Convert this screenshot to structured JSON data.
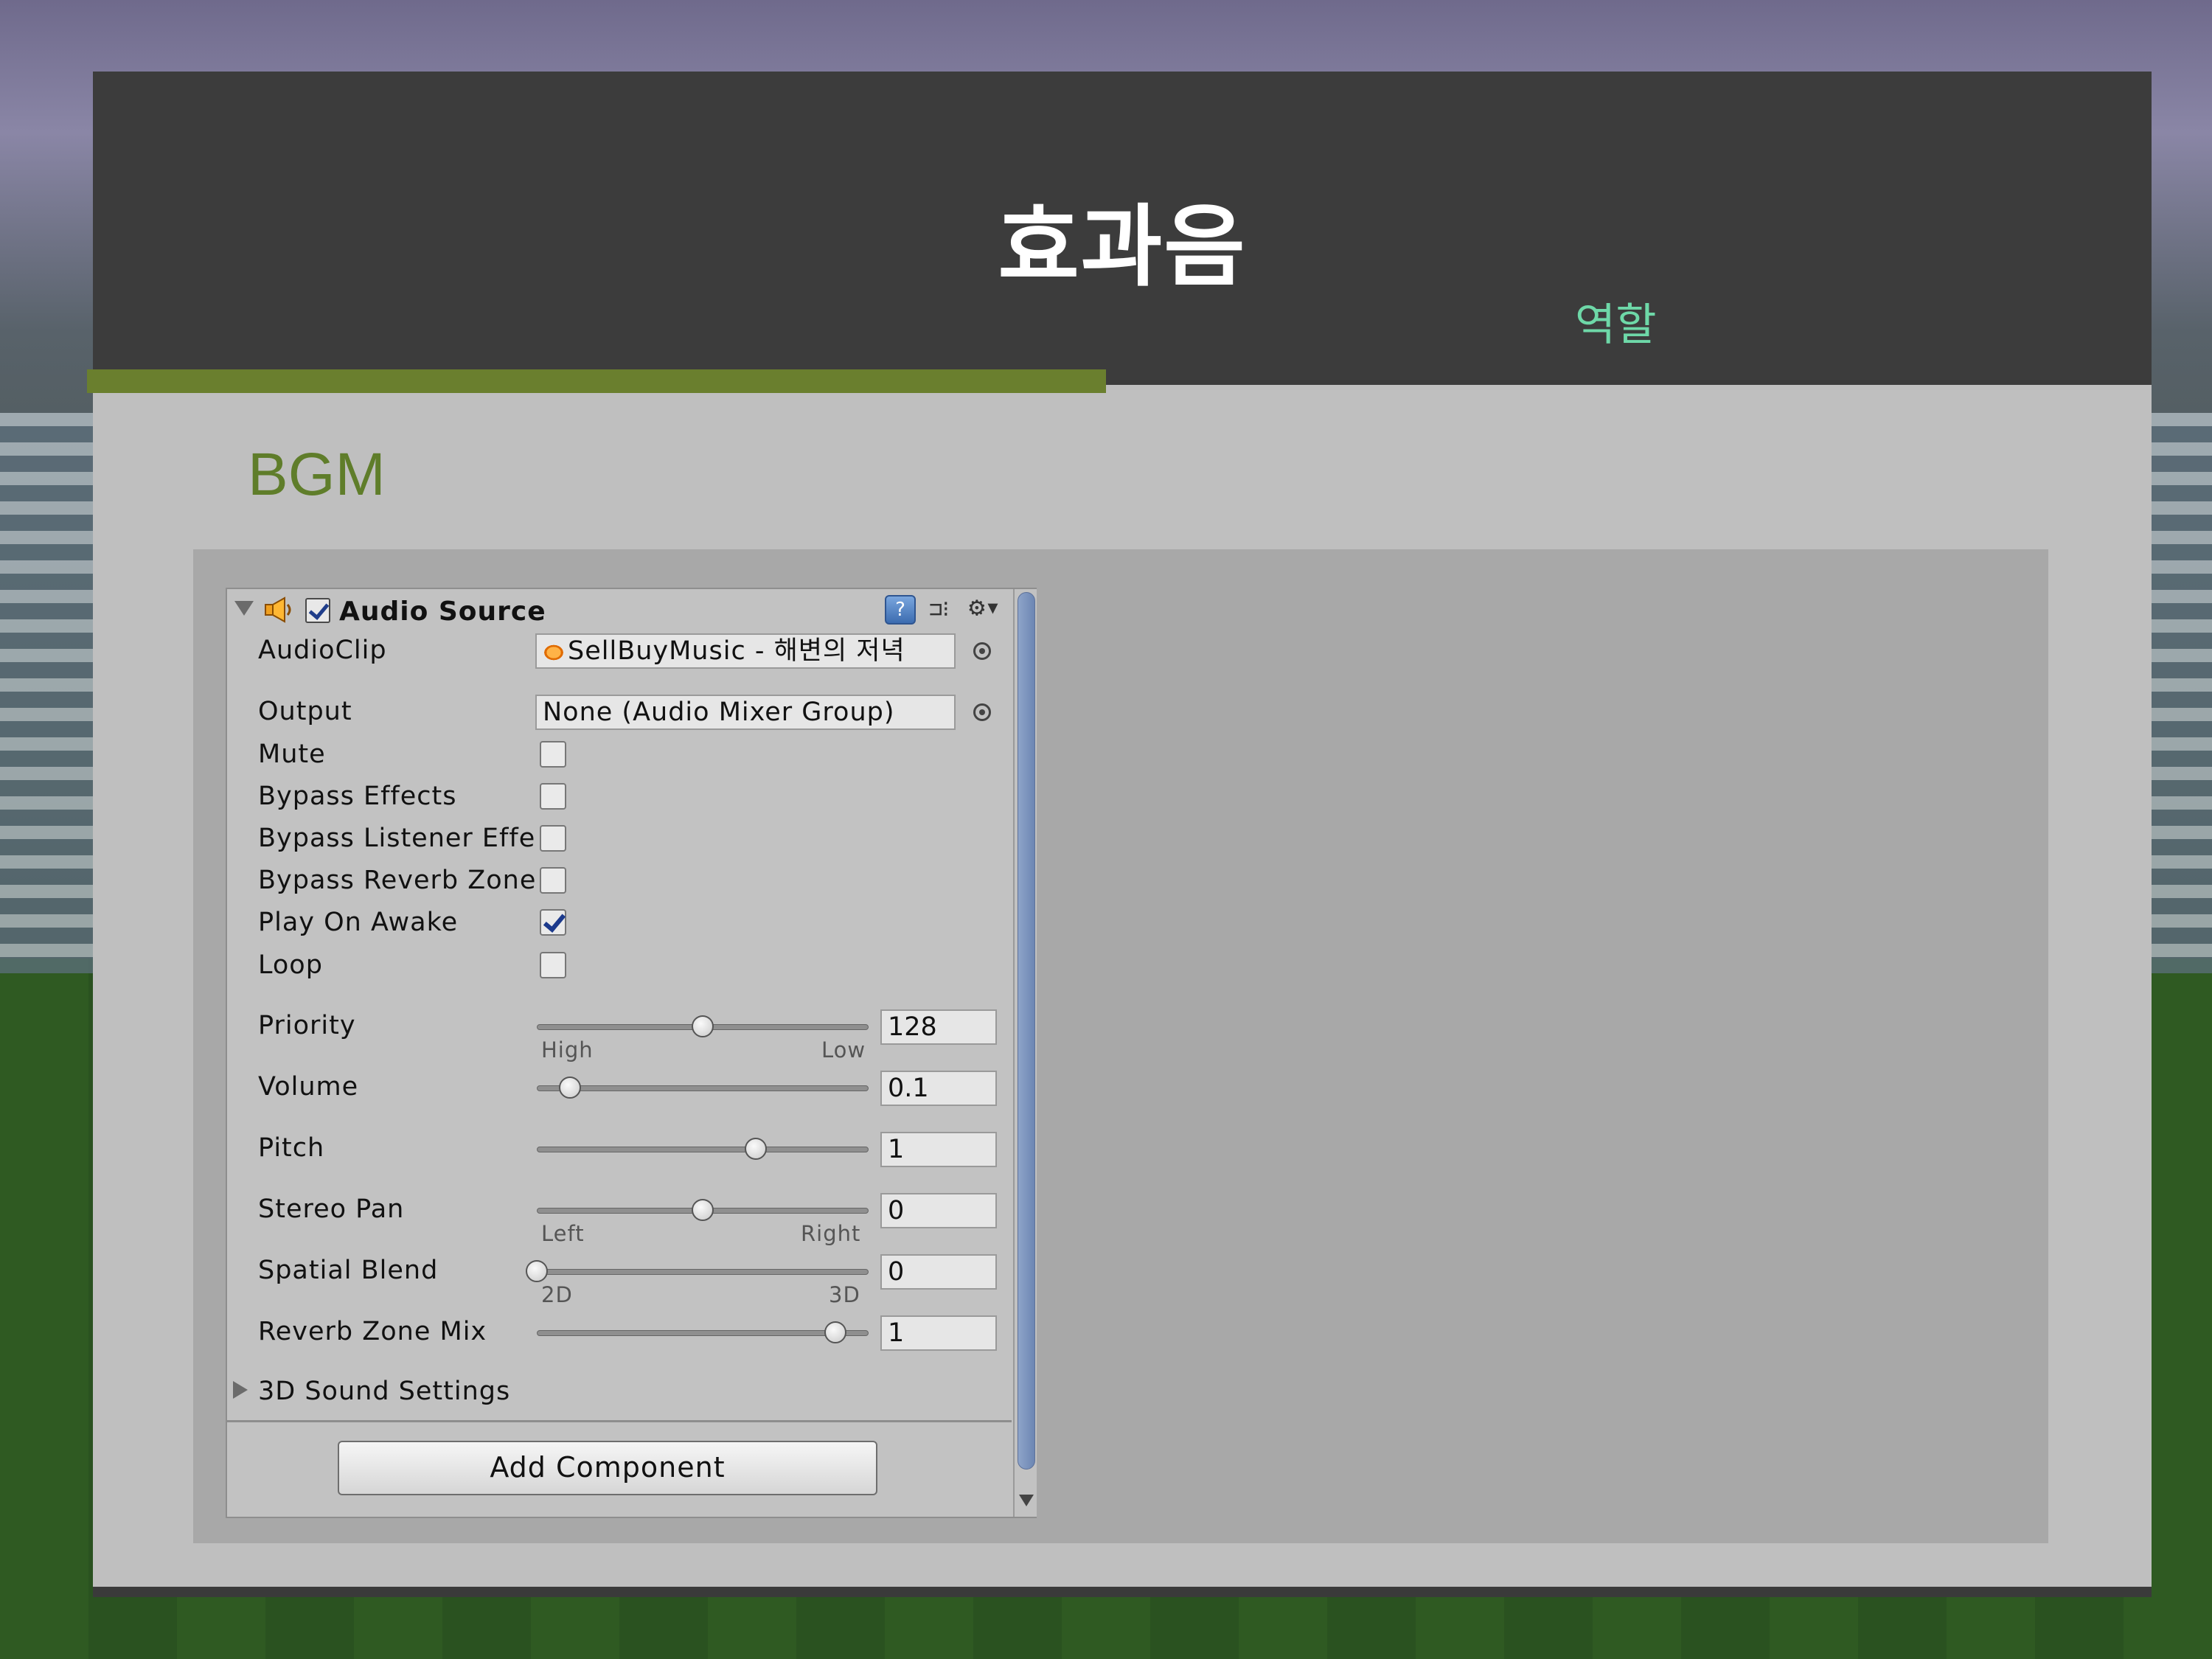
{
  "slide": {
    "title": "효과음",
    "subtitle": "역할",
    "section_heading": "BGM"
  },
  "colors": {
    "header_bg": "#3c3c3c",
    "accent_bar": "#6a7f2e",
    "section_heading": "#5f7d2a",
    "subtitle": "#6ed8a8",
    "slide_bg": "#bfbfbf",
    "content_bg": "#a8a8a8"
  },
  "inspector": {
    "component_title": "Audio Source",
    "component_enabled": true,
    "icons": [
      "speaker-icon",
      "help-icon",
      "preset-icon",
      "gear-icon"
    ],
    "audio_clip": {
      "label": "AudioClip",
      "value": "SellBuyMusic - 해변의 저녁"
    },
    "output": {
      "label": "Output",
      "value": "None (Audio Mixer Group)"
    },
    "toggles": [
      {
        "label": "Mute",
        "checked": false
      },
      {
        "label": "Bypass Effects",
        "checked": false
      },
      {
        "label": "Bypass Listener Effe",
        "checked": false
      },
      {
        "label": "Bypass Reverb Zone",
        "checked": false
      },
      {
        "label": "Play On Awake",
        "checked": true
      },
      {
        "label": "Loop",
        "checked": false
      }
    ],
    "sliders": [
      {
        "label": "Priority",
        "value": "128",
        "fraction": 0.5,
        "min_label": "High",
        "max_label": "Low"
      },
      {
        "label": "Volume",
        "value": "0.1",
        "fraction": 0.1,
        "min_label": "",
        "max_label": ""
      },
      {
        "label": "Pitch",
        "value": "1",
        "fraction": 0.66,
        "min_label": "",
        "max_label": ""
      },
      {
        "label": "Stereo Pan",
        "value": "0",
        "fraction": 0.5,
        "min_label": "Left",
        "max_label": "Right"
      },
      {
        "label": "Spatial Blend",
        "value": "0",
        "fraction": 0.0,
        "min_label": "2D",
        "max_label": "3D"
      },
      {
        "label": "Reverb Zone Mix",
        "value": "1",
        "fraction": 0.9,
        "min_label": "",
        "max_label": ""
      }
    ],
    "sound_settings_foldout": "3D Sound Settings",
    "add_component_label": "Add Component"
  }
}
